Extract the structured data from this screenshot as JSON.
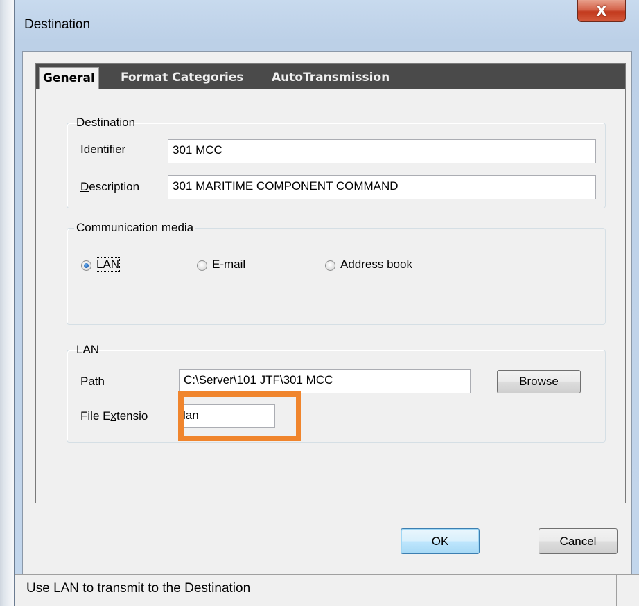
{
  "window": {
    "title": "Destination",
    "close_glyph": "X"
  },
  "tabs": [
    {
      "label": "General",
      "active": true
    },
    {
      "label": "Format Categories",
      "active": false
    },
    {
      "label": "AutoTransmission",
      "active": false
    }
  ],
  "destination_group": {
    "legend": "Destination",
    "identifier_label": "Identifier",
    "identifier_value": "301 MCC",
    "description_label": "Description",
    "description_value": "301 MARITIME COMPONENT COMMAND"
  },
  "media_group": {
    "legend": "Communication media",
    "options": [
      {
        "label": "LAN",
        "checked": true
      },
      {
        "label": "E-mail",
        "checked": false
      },
      {
        "label": "Address book",
        "checked": false
      }
    ]
  },
  "lan_group": {
    "legend": "LAN",
    "path_label": "Path",
    "path_value": "C:\\Server\\101 JTF\\301 MCC",
    "browse_label": "Browse",
    "extension_label": "File Extension",
    "extension_value": "lan"
  },
  "buttons": {
    "ok": "OK",
    "cancel": "Cancel"
  },
  "status": {
    "text": "Use LAN to transmit to the Destination"
  },
  "colors": {
    "highlight": "#f0852d",
    "tab_strip": "#4a4a4a",
    "close_button": "#c2391d"
  }
}
